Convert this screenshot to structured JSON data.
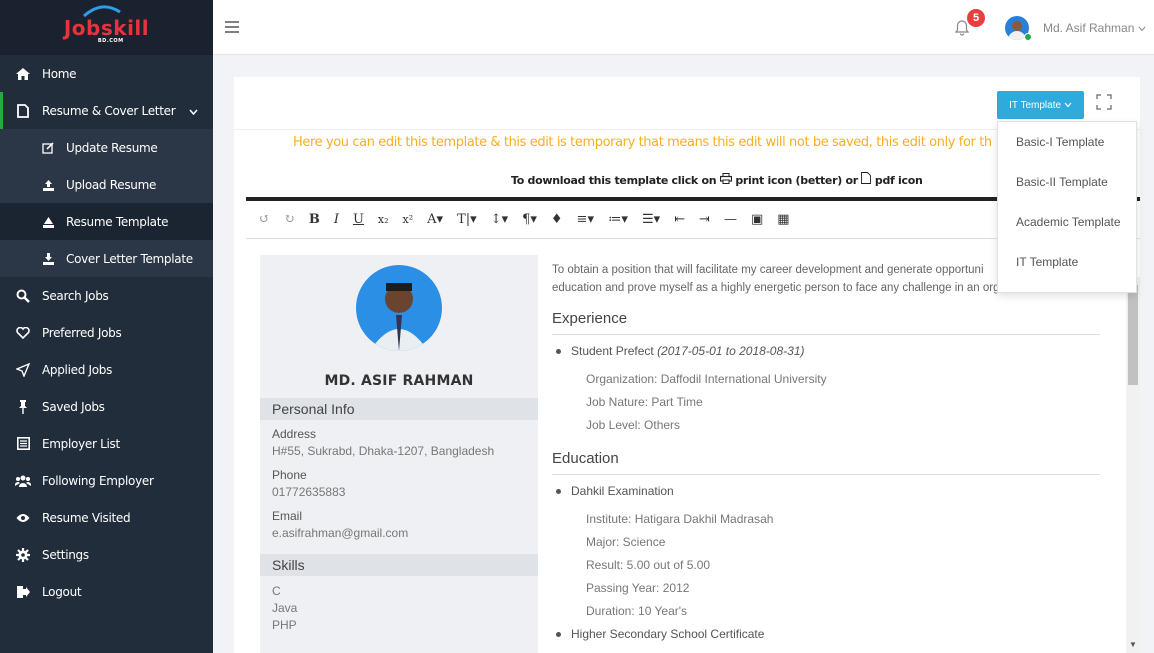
{
  "brand": {
    "logo_text": "Jobskill",
    "logo_sub": "BD.COM"
  },
  "sidebar": {
    "items": [
      {
        "label": "Home",
        "icon": "home-icon"
      },
      {
        "label": "Resume & Cover Letter",
        "icon": "file-icon"
      },
      {
        "label": "Update Resume",
        "icon": "edit-icon"
      },
      {
        "label": "Upload Resume",
        "icon": "upload-icon"
      },
      {
        "label": "Resume Template",
        "icon": "template-icon"
      },
      {
        "label": "Cover Letter Template",
        "icon": "download-icon"
      },
      {
        "label": "Search Jobs",
        "icon": "search-icon"
      },
      {
        "label": "Preferred Jobs",
        "icon": "heart-icon"
      },
      {
        "label": "Applied Jobs",
        "icon": "send-icon"
      },
      {
        "label": "Saved Jobs",
        "icon": "pin-icon"
      },
      {
        "label": "Employer List",
        "icon": "list-icon"
      },
      {
        "label": "Following Employer",
        "icon": "users-icon"
      },
      {
        "label": "Resume Visited",
        "icon": "eye-icon"
      },
      {
        "label": "Settings",
        "icon": "gear-icon"
      },
      {
        "label": "Logout",
        "icon": "logout-icon"
      }
    ]
  },
  "topbar": {
    "notification_count": "5",
    "user_name": "Md. Asif Rahman"
  },
  "card": {
    "template_button": "IT Template",
    "notice": "Here you can edit this template & this edit is temporary that means this edit will not be saved, this edit only for th",
    "download_prefix": "To download this template click on",
    "download_print": "print icon (better) or",
    "download_pdf": "pdf icon"
  },
  "dropdown": {
    "items": [
      "Basic-I Template",
      "Basic-II Template",
      "Academic Template",
      "IT Template"
    ]
  },
  "resume": {
    "name": "MD. ASIF RAHMAN",
    "personal_info_title": "Personal Info",
    "address_label": "Address",
    "address_value": "H#55, Sukrabd, Dhaka-1207, Bangladesh",
    "phone_label": "Phone",
    "phone_value": "01772635883",
    "email_label": "Email",
    "email_value": "e.asifrahman@gmail.com",
    "skills_title": "Skills",
    "skills": [
      "C",
      "Java",
      "PHP"
    ],
    "objective_line1": "To obtain a position that will facilitate my career development and generate opportuni",
    "objective_line2": "education and prove myself as a highly energetic person to face any challenge in an organization.",
    "experience_title": "Experience",
    "exp_role": "Student Prefect",
    "exp_dates": "(2017-05-01 to 2018-08-31)",
    "exp_org": "Organization: Daffodil International University",
    "exp_nature": "Job Nature: Part Time",
    "exp_level": "Job Level: Others",
    "education_title": "Education",
    "edu1": "Dahkil Examination",
    "edu1_institute": "Institute: Hatigara Dakhil Madrasah",
    "edu1_major": "Major: Science",
    "edu1_result": "Result: 5.00 out of 5.00",
    "edu1_year": "Passing Year: 2012",
    "edu1_duration": "Duration: 10 Year's",
    "edu2": "Higher Secondary School Certificate"
  }
}
